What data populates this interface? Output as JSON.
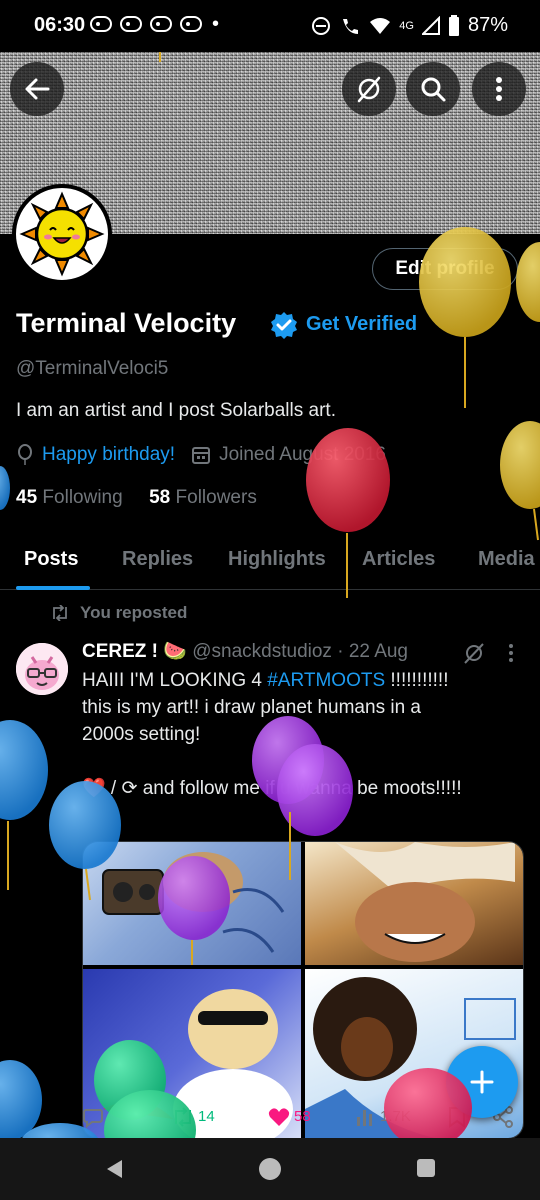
{
  "status_bar": {
    "time": "06:30",
    "network": "4G",
    "battery": "87%"
  },
  "profile": {
    "display_name": "Terminal Velocity",
    "get_verified_label": "Get Verified",
    "handle": "@TerminalVeloci5",
    "bio": "I am an artist and I post Solarballs art.",
    "birthday_label": "Happy birthday!",
    "joined_label": "Joined August 2016",
    "following_count": "45",
    "following_label": "Following",
    "followers_count": "58",
    "followers_label": "Followers",
    "edit_profile_label": "Edit profile"
  },
  "tabs": [
    {
      "label": "Posts",
      "active": true
    },
    {
      "label": "Replies",
      "active": false
    },
    {
      "label": "Highlights",
      "active": false
    },
    {
      "label": "Articles",
      "active": false
    },
    {
      "label": "Media",
      "active": false
    }
  ],
  "post": {
    "repost_label": "You reposted",
    "author_name": "CEREZ !",
    "author_emoji": "🍉",
    "author_handle": "@snackdstudioz",
    "date": "· 22 Aug",
    "text_line1_a": "HAIII I'M LOOKING 4 ",
    "hashtag": "#ARTMOOTS",
    "text_line1_b": " !!!!!!!!!!!",
    "text_line2": "this is my art!! i draw planet humans in a",
    "text_line3": "2000s setting!",
    "text_line4": "❤️ / ⟳ and follow me if u wanna be moots!!!!!",
    "replies": "",
    "reposts": "14",
    "likes": "58",
    "views": "1.7K"
  },
  "colors": {
    "accent": "#1d9bf0",
    "background": "#000000",
    "muted": "#71767b",
    "like": "#f91880",
    "repost": "#00ba7c"
  }
}
